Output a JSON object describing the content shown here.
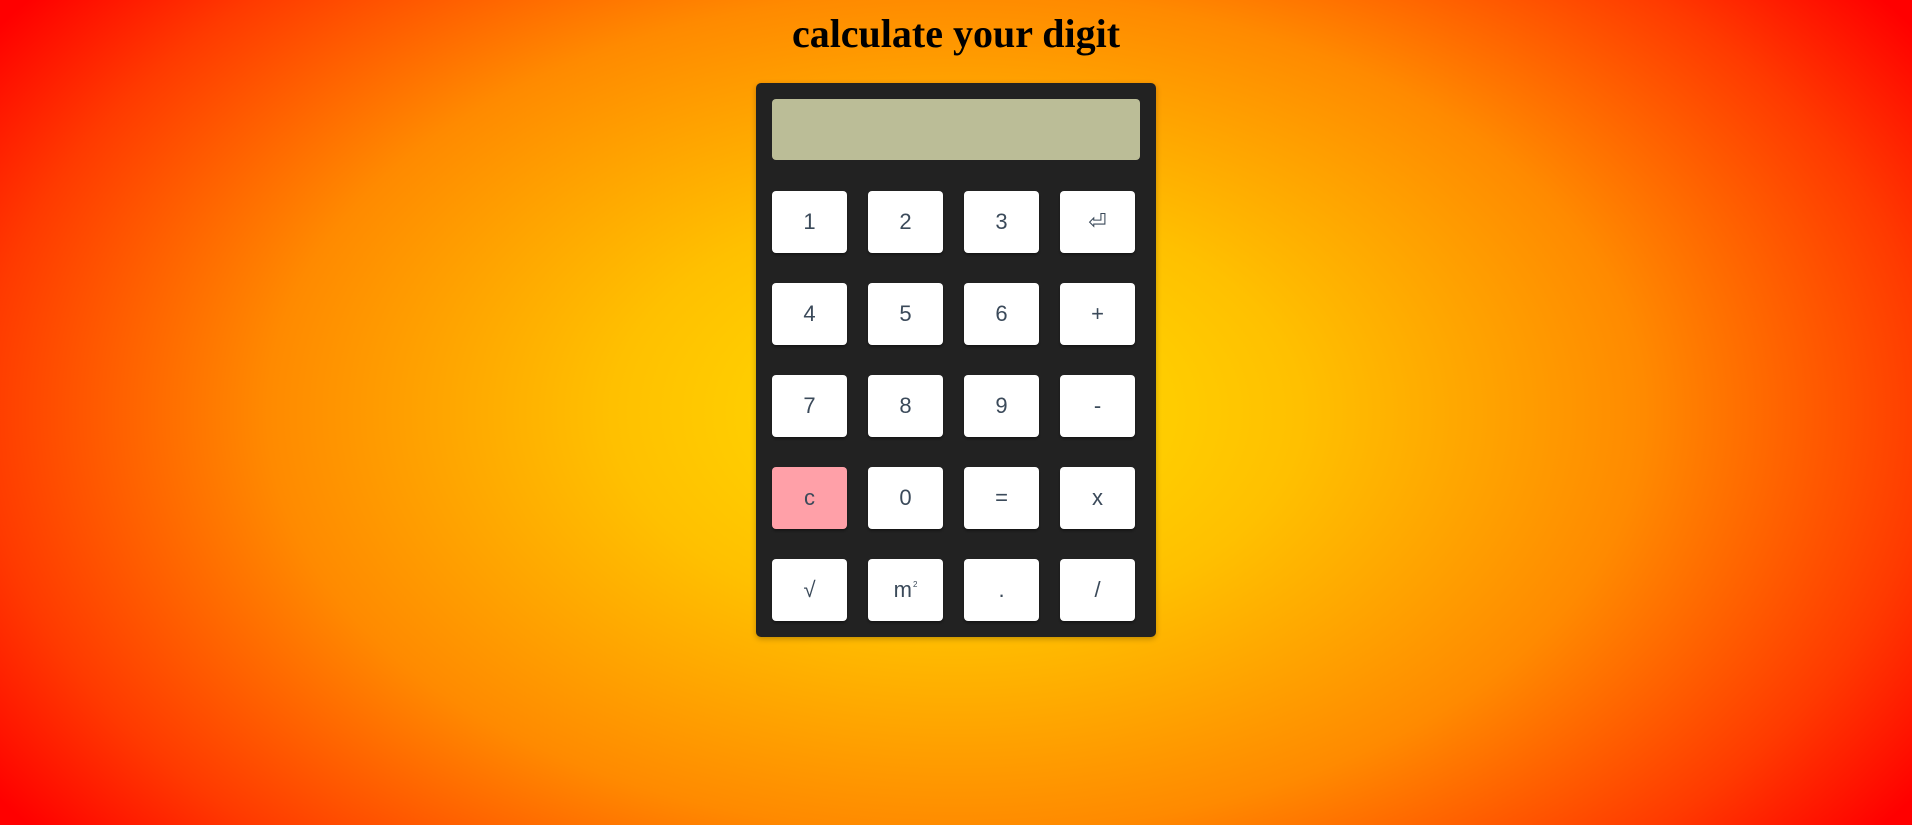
{
  "page": {
    "title": "calculate your digit"
  },
  "display": {
    "value": ""
  },
  "keys": [
    {
      "id": "key-1",
      "label": "1"
    },
    {
      "id": "key-2",
      "label": "2"
    },
    {
      "id": "key-3",
      "label": "3"
    },
    {
      "id": "key-backspace",
      "label": "⏎"
    },
    {
      "id": "key-4",
      "label": "4"
    },
    {
      "id": "key-5",
      "label": "5"
    },
    {
      "id": "key-6",
      "label": "6"
    },
    {
      "id": "key-plus",
      "label": "+"
    },
    {
      "id": "key-7",
      "label": "7"
    },
    {
      "id": "key-8",
      "label": "8"
    },
    {
      "id": "key-9",
      "label": "9"
    },
    {
      "id": "key-minus",
      "label": "-"
    },
    {
      "id": "key-clear",
      "label": "c"
    },
    {
      "id": "key-0",
      "label": "0"
    },
    {
      "id": "key-equals",
      "label": "="
    },
    {
      "id": "key-multiply",
      "label": "x"
    },
    {
      "id": "key-sqrt",
      "label": "√"
    },
    {
      "id": "key-square",
      "label": "m",
      "sup": "2"
    },
    {
      "id": "key-decimal",
      "label": "."
    },
    {
      "id": "key-divide",
      "label": "/"
    }
  ],
  "colors": {
    "calculator_body": "#222222",
    "display_bg": "#bbbd97",
    "key_bg": "#ffffff",
    "clear_key_bg": "#ffa0a8",
    "key_text": "#3b4a5a"
  }
}
